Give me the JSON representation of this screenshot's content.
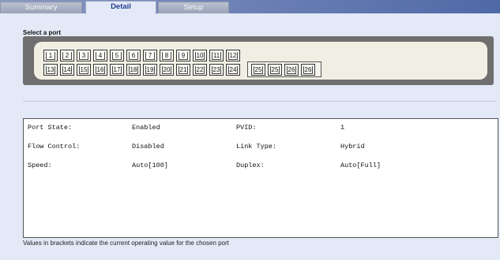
{
  "tabs": {
    "summary": "Summary",
    "detail": "Detail",
    "setup": "Setup"
  },
  "port_selector": {
    "label": "Select a port",
    "row1": [
      "1",
      "2",
      "3",
      "4",
      "5",
      "6",
      "7",
      "8",
      "9",
      "10",
      "11",
      "12"
    ],
    "row2": [
      "13",
      "14",
      "15",
      "16",
      "17",
      "18",
      "19",
      "20",
      "21",
      "22",
      "23",
      "24"
    ],
    "combo": [
      "25",
      "25",
      "26",
      "26"
    ],
    "selected": "11"
  },
  "details": {
    "port_state": {
      "label": "Port State:",
      "value": "Enabled"
    },
    "pvid": {
      "label": "PVID:",
      "value": "1"
    },
    "flow_control": {
      "label": "Flow Control:",
      "value": "Disabled"
    },
    "link_type": {
      "label": "Link Type:",
      "value": "Hybrid"
    },
    "speed": {
      "label": "Speed:",
      "value": "Auto[100]"
    },
    "duplex": {
      "label": "Duplex:",
      "value": "Auto[Full]"
    }
  },
  "footnote": "Values in brackets indicate the current operating value for the chosen port",
  "colors": {
    "selected_port": "#2e45c2",
    "tabbar": "#6f82b6",
    "background": "#e3e9f6"
  }
}
